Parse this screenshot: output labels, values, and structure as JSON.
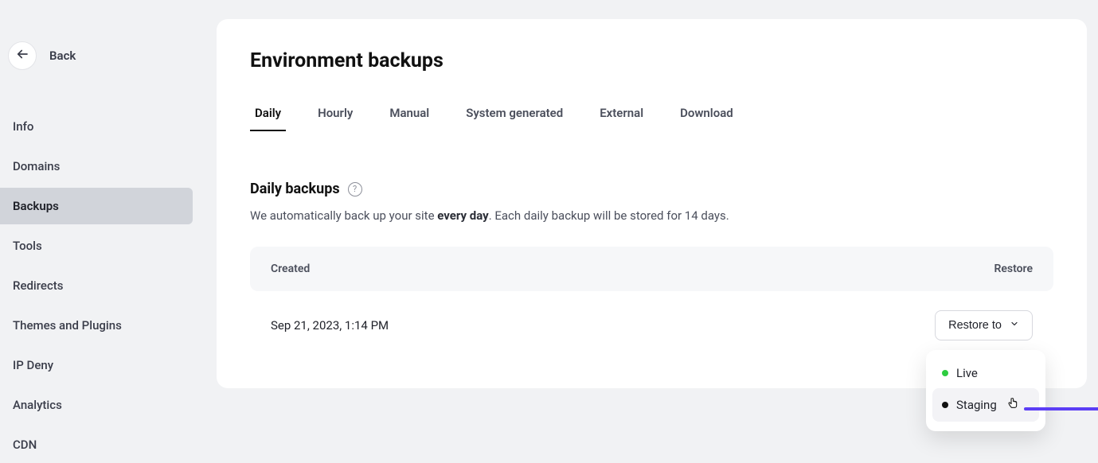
{
  "sidebar": {
    "back_label": "Back",
    "items": [
      {
        "label": "Info",
        "active": false
      },
      {
        "label": "Domains",
        "active": false
      },
      {
        "label": "Backups",
        "active": true
      },
      {
        "label": "Tools",
        "active": false
      },
      {
        "label": "Redirects",
        "active": false
      },
      {
        "label": "Themes and Plugins",
        "active": false
      },
      {
        "label": "IP Deny",
        "active": false
      },
      {
        "label": "Analytics",
        "active": false
      },
      {
        "label": "CDN",
        "active": false
      }
    ]
  },
  "page": {
    "title": "Environment backups"
  },
  "tabs": [
    {
      "label": "Daily",
      "active": true
    },
    {
      "label": "Hourly",
      "active": false
    },
    {
      "label": "Manual",
      "active": false
    },
    {
      "label": "System generated",
      "active": false
    },
    {
      "label": "External",
      "active": false
    },
    {
      "label": "Download",
      "active": false
    }
  ],
  "section": {
    "title": "Daily backups",
    "help_glyph": "?",
    "desc_prefix": "We automatically back up your site ",
    "desc_bold": "every day",
    "desc_suffix": ". Each daily backup will be stored for 14 days."
  },
  "table": {
    "header_created": "Created",
    "header_restore": "Restore",
    "rows": [
      {
        "created": "Sep 21, 2023, 1:14 PM"
      }
    ]
  },
  "restore_button": {
    "label": "Restore to"
  },
  "dropdown": {
    "items": [
      {
        "label": "Live",
        "dot": "green",
        "hover": false
      },
      {
        "label": "Staging",
        "dot": "black",
        "hover": true
      }
    ]
  }
}
